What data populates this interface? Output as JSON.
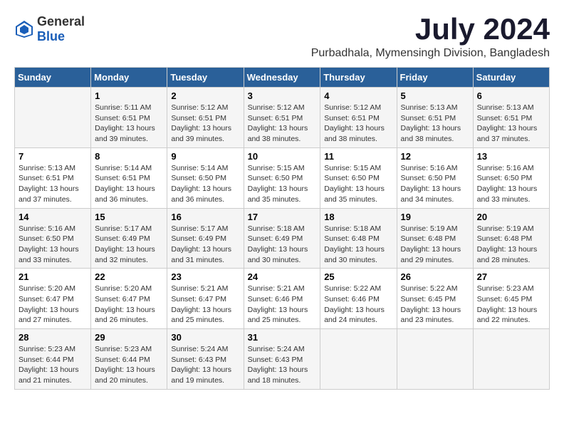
{
  "header": {
    "logo_general": "General",
    "logo_blue": "Blue",
    "month_year": "July 2024",
    "location": "Purbadhala, Mymensingh Division, Bangladesh"
  },
  "weekdays": [
    "Sunday",
    "Monday",
    "Tuesday",
    "Wednesday",
    "Thursday",
    "Friday",
    "Saturday"
  ],
  "weeks": [
    [
      {
        "day": "",
        "sunrise": "",
        "sunset": "",
        "daylight": ""
      },
      {
        "day": "1",
        "sunrise": "Sunrise: 5:11 AM",
        "sunset": "Sunset: 6:51 PM",
        "daylight": "Daylight: 13 hours and 39 minutes."
      },
      {
        "day": "2",
        "sunrise": "Sunrise: 5:12 AM",
        "sunset": "Sunset: 6:51 PM",
        "daylight": "Daylight: 13 hours and 39 minutes."
      },
      {
        "day": "3",
        "sunrise": "Sunrise: 5:12 AM",
        "sunset": "Sunset: 6:51 PM",
        "daylight": "Daylight: 13 hours and 38 minutes."
      },
      {
        "day": "4",
        "sunrise": "Sunrise: 5:12 AM",
        "sunset": "Sunset: 6:51 PM",
        "daylight": "Daylight: 13 hours and 38 minutes."
      },
      {
        "day": "5",
        "sunrise": "Sunrise: 5:13 AM",
        "sunset": "Sunset: 6:51 PM",
        "daylight": "Daylight: 13 hours and 38 minutes."
      },
      {
        "day": "6",
        "sunrise": "Sunrise: 5:13 AM",
        "sunset": "Sunset: 6:51 PM",
        "daylight": "Daylight: 13 hours and 37 minutes."
      }
    ],
    [
      {
        "day": "7",
        "sunrise": "Sunrise: 5:13 AM",
        "sunset": "Sunset: 6:51 PM",
        "daylight": "Daylight: 13 hours and 37 minutes."
      },
      {
        "day": "8",
        "sunrise": "Sunrise: 5:14 AM",
        "sunset": "Sunset: 6:51 PM",
        "daylight": "Daylight: 13 hours and 36 minutes."
      },
      {
        "day": "9",
        "sunrise": "Sunrise: 5:14 AM",
        "sunset": "Sunset: 6:50 PM",
        "daylight": "Daylight: 13 hours and 36 minutes."
      },
      {
        "day": "10",
        "sunrise": "Sunrise: 5:15 AM",
        "sunset": "Sunset: 6:50 PM",
        "daylight": "Daylight: 13 hours and 35 minutes."
      },
      {
        "day": "11",
        "sunrise": "Sunrise: 5:15 AM",
        "sunset": "Sunset: 6:50 PM",
        "daylight": "Daylight: 13 hours and 35 minutes."
      },
      {
        "day": "12",
        "sunrise": "Sunrise: 5:16 AM",
        "sunset": "Sunset: 6:50 PM",
        "daylight": "Daylight: 13 hours and 34 minutes."
      },
      {
        "day": "13",
        "sunrise": "Sunrise: 5:16 AM",
        "sunset": "Sunset: 6:50 PM",
        "daylight": "Daylight: 13 hours and 33 minutes."
      }
    ],
    [
      {
        "day": "14",
        "sunrise": "Sunrise: 5:16 AM",
        "sunset": "Sunset: 6:50 PM",
        "daylight": "Daylight: 13 hours and 33 minutes."
      },
      {
        "day": "15",
        "sunrise": "Sunrise: 5:17 AM",
        "sunset": "Sunset: 6:49 PM",
        "daylight": "Daylight: 13 hours and 32 minutes."
      },
      {
        "day": "16",
        "sunrise": "Sunrise: 5:17 AM",
        "sunset": "Sunset: 6:49 PM",
        "daylight": "Daylight: 13 hours and 31 minutes."
      },
      {
        "day": "17",
        "sunrise": "Sunrise: 5:18 AM",
        "sunset": "Sunset: 6:49 PM",
        "daylight": "Daylight: 13 hours and 30 minutes."
      },
      {
        "day": "18",
        "sunrise": "Sunrise: 5:18 AM",
        "sunset": "Sunset: 6:48 PM",
        "daylight": "Daylight: 13 hours and 30 minutes."
      },
      {
        "day": "19",
        "sunrise": "Sunrise: 5:19 AM",
        "sunset": "Sunset: 6:48 PM",
        "daylight": "Daylight: 13 hours and 29 minutes."
      },
      {
        "day": "20",
        "sunrise": "Sunrise: 5:19 AM",
        "sunset": "Sunset: 6:48 PM",
        "daylight": "Daylight: 13 hours and 28 minutes."
      }
    ],
    [
      {
        "day": "21",
        "sunrise": "Sunrise: 5:20 AM",
        "sunset": "Sunset: 6:47 PM",
        "daylight": "Daylight: 13 hours and 27 minutes."
      },
      {
        "day": "22",
        "sunrise": "Sunrise: 5:20 AM",
        "sunset": "Sunset: 6:47 PM",
        "daylight": "Daylight: 13 hours and 26 minutes."
      },
      {
        "day": "23",
        "sunrise": "Sunrise: 5:21 AM",
        "sunset": "Sunset: 6:47 PM",
        "daylight": "Daylight: 13 hours and 25 minutes."
      },
      {
        "day": "24",
        "sunrise": "Sunrise: 5:21 AM",
        "sunset": "Sunset: 6:46 PM",
        "daylight": "Daylight: 13 hours and 25 minutes."
      },
      {
        "day": "25",
        "sunrise": "Sunrise: 5:22 AM",
        "sunset": "Sunset: 6:46 PM",
        "daylight": "Daylight: 13 hours and 24 minutes."
      },
      {
        "day": "26",
        "sunrise": "Sunrise: 5:22 AM",
        "sunset": "Sunset: 6:45 PM",
        "daylight": "Daylight: 13 hours and 23 minutes."
      },
      {
        "day": "27",
        "sunrise": "Sunrise: 5:23 AM",
        "sunset": "Sunset: 6:45 PM",
        "daylight": "Daylight: 13 hours and 22 minutes."
      }
    ],
    [
      {
        "day": "28",
        "sunrise": "Sunrise: 5:23 AM",
        "sunset": "Sunset: 6:44 PM",
        "daylight": "Daylight: 13 hours and 21 minutes."
      },
      {
        "day": "29",
        "sunrise": "Sunrise: 5:23 AM",
        "sunset": "Sunset: 6:44 PM",
        "daylight": "Daylight: 13 hours and 20 minutes."
      },
      {
        "day": "30",
        "sunrise": "Sunrise: 5:24 AM",
        "sunset": "Sunset: 6:43 PM",
        "daylight": "Daylight: 13 hours and 19 minutes."
      },
      {
        "day": "31",
        "sunrise": "Sunrise: 5:24 AM",
        "sunset": "Sunset: 6:43 PM",
        "daylight": "Daylight: 13 hours and 18 minutes."
      },
      {
        "day": "",
        "sunrise": "",
        "sunset": "",
        "daylight": ""
      },
      {
        "day": "",
        "sunrise": "",
        "sunset": "",
        "daylight": ""
      },
      {
        "day": "",
        "sunrise": "",
        "sunset": "",
        "daylight": ""
      }
    ]
  ]
}
